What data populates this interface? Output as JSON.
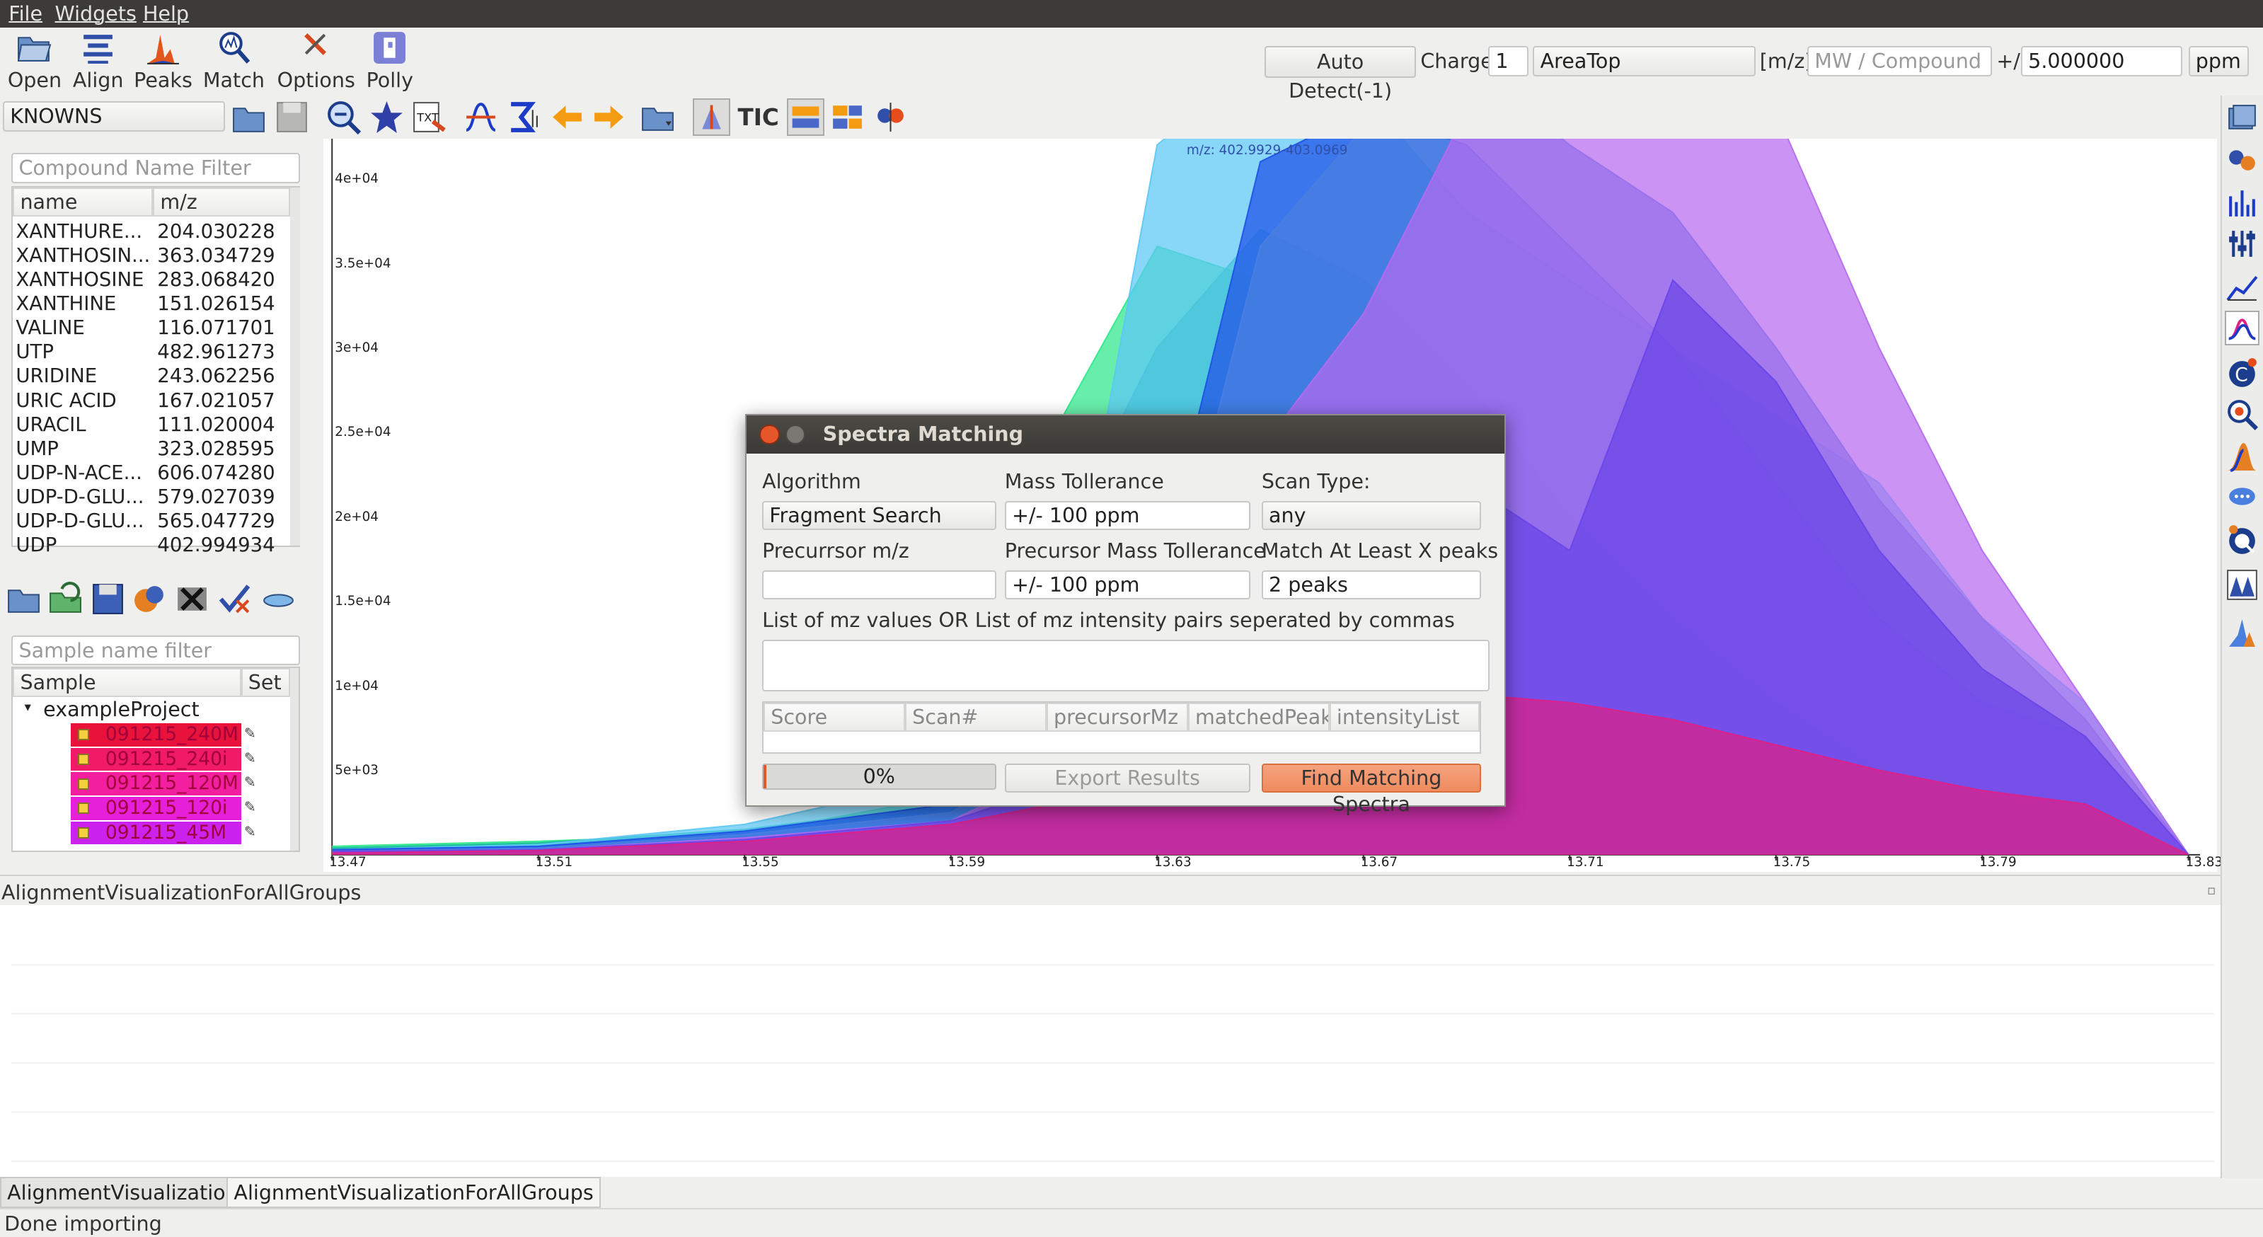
{
  "menu": {
    "file": "File",
    "widgets": "Widgets",
    "help": "Help"
  },
  "toolbar": {
    "open": "Open",
    "align": "Align",
    "peaks": "Peaks",
    "match": "Match",
    "options": "Options",
    "polly": "Polly"
  },
  "massbar": {
    "auto_detect": "Auto Detect(-1)",
    "charge_label": "Charge",
    "charge_value": "1",
    "area_mode": "AreaTop",
    "mz_label": "[m/z]",
    "compound_placeholder": "MW / Compound",
    "plusminus": "+/-",
    "tolerance": "5.000000",
    "unit": "ppm"
  },
  "library": {
    "selected": "KNOWNS"
  },
  "tic_label": "TIC",
  "compounds": {
    "filter_placeholder": "Compound Name Filter",
    "columns": [
      "name",
      "m/z"
    ],
    "rows": [
      {
        "name": "XANTHURE...",
        "mz": "204.030228"
      },
      {
        "name": "XANTHOSIN...",
        "mz": "363.034729"
      },
      {
        "name": "XANTHOSINE",
        "mz": "283.068420"
      },
      {
        "name": "XANTHINE",
        "mz": "151.026154"
      },
      {
        "name": "VALINE",
        "mz": "116.071701"
      },
      {
        "name": "UTP",
        "mz": "482.961273"
      },
      {
        "name": "URIDINE",
        "mz": "243.062256"
      },
      {
        "name": "URIC ACID",
        "mz": "167.021057"
      },
      {
        "name": "URACIL",
        "mz": "111.020004"
      },
      {
        "name": "UMP",
        "mz": "323.028595"
      },
      {
        "name": "UDP-N-ACE...",
        "mz": "606.074280"
      },
      {
        "name": "UDP-D-GLU...",
        "mz": "579.027039"
      },
      {
        "name": "UDP-D-GLU...",
        "mz": "565.047729"
      },
      {
        "name": "UDP",
        "mz": "402.994934"
      }
    ]
  },
  "samples": {
    "filter_placeholder": "Sample name filter",
    "columns": [
      "Sample",
      "Set"
    ],
    "project": "exampleProject",
    "rows": [
      {
        "name": "091215_240M",
        "color": "#e8123a"
      },
      {
        "name": "091215_240i",
        "color": "#f01a66"
      },
      {
        "name": "091215_120M",
        "color": "#f21fa0"
      },
      {
        "name": "091215_120i",
        "color": "#e61fd8"
      },
      {
        "name": "091215_45M",
        "color": "#cc22ee"
      }
    ]
  },
  "plot": {
    "header": "m/z: 402.9929-403.0969",
    "yticks": [
      "4e+04",
      "3.5e+04",
      "3e+04",
      "2.5e+04",
      "2e+04",
      "1.5e+04",
      "1e+04",
      "5e+03"
    ],
    "xticks": [
      "13.47",
      "13.51",
      "13.55",
      "13.59",
      "13.63",
      "13.67",
      "13.71",
      "13.75",
      "13.79",
      "13.83"
    ]
  },
  "chart_data": {
    "type": "area",
    "title": "",
    "xlabel": "",
    "ylabel": "",
    "x": [
      13.47,
      13.51,
      13.55,
      13.59,
      13.61,
      13.63,
      13.65,
      13.67,
      13.69,
      13.71,
      13.73,
      13.75,
      13.77,
      13.79,
      13.81,
      13.83
    ],
    "xlim": [
      13.47,
      13.83
    ],
    "ylim": [
      0,
      41000
    ],
    "series": [
      {
        "color": "#2ee88a",
        "values": [
          500,
          800,
          1200,
          3500,
          25000,
          36000,
          34000,
          26000,
          19000,
          14000,
          10000,
          6000,
          4000,
          3000,
          2500,
          0
        ]
      },
      {
        "color": "#1abc9c",
        "values": [
          400,
          700,
          1500,
          3000,
          18000,
          30000,
          37000,
          34000,
          28000,
          20000,
          14000,
          9000,
          5000,
          3500,
          2500,
          0
        ]
      },
      {
        "color": "#5cc8f5",
        "values": [
          300,
          600,
          1800,
          4500,
          9000,
          42000,
          47000,
          45000,
          38000,
          34000,
          30000,
          26000,
          22000,
          14000,
          9000,
          0
        ]
      },
      {
        "color": "#1e50e8",
        "values": [
          300,
          500,
          1400,
          3000,
          8000,
          16000,
          41000,
          44000,
          42000,
          36000,
          30000,
          22000,
          14000,
          9000,
          7000,
          0
        ]
      },
      {
        "color": "#4a7fe0",
        "values": [
          200,
          400,
          1200,
          2500,
          6000,
          12000,
          36000,
          43000,
          47000,
          42000,
          38000,
          30000,
          21000,
          14000,
          8000,
          0
        ]
      },
      {
        "color": "#b56af0",
        "values": [
          200,
          300,
          1000,
          2000,
          5000,
          10000,
          24000,
          32000,
          44000,
          52000,
          48000,
          44000,
          30000,
          18000,
          9000,
          0
        ]
      },
      {
        "color": "#6a44e8",
        "values": [
          200,
          300,
          900,
          2000,
          4000,
          9000,
          14000,
          20000,
          22000,
          18000,
          34000,
          28000,
          18000,
          11000,
          7000,
          0
        ]
      },
      {
        "color": "#e01f85",
        "values": [
          100,
          250,
          800,
          1800,
          3000,
          4500,
          6500,
          8000,
          9500,
          9000,
          8000,
          6500,
          5000,
          3800,
          3000,
          0
        ]
      }
    ]
  },
  "dialog": {
    "title": "Spectra Matching",
    "algorithm_label": "Algorithm",
    "algorithm_value": "Fragment Search",
    "mass_tol_label": "Mass Tollerance",
    "mass_tol_value": "+/- 100 ppm",
    "scan_type_label": "Scan Type:",
    "scan_type_value": "any",
    "precursor_mz_label": "Precurrsor m/z",
    "precursor_mz_value": "",
    "precursor_tol_label": "Precursor Mass  Tollerance",
    "precursor_tol_value": "+/- 100 ppm",
    "min_peaks_label": "Match At Least X peaks",
    "min_peaks_value": "2 peaks",
    "mz_list_label": "List of mz values OR List of mz intensity pairs seperated by commas",
    "columns": [
      "Score",
      "Scan#",
      "precursorMz",
      "matchedPeaks",
      "intensityList"
    ],
    "progress": 0,
    "progress_text": "0%",
    "export_label": "Export Results",
    "find_label": "Find Matching Spectra"
  },
  "bottom": {
    "panel_title": "AlignmentVisualizationForAllGroups",
    "tabs": [
      "AlignmentVisualization",
      "AlignmentVisualizationForAllGroups"
    ]
  },
  "status": {
    "text": "Done importing"
  }
}
